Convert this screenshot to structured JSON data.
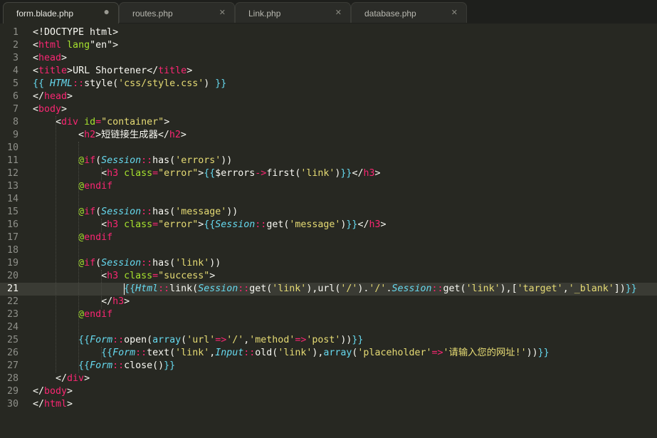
{
  "tabs": [
    {
      "title": "form.blade.php",
      "active": true,
      "dirty": true
    },
    {
      "title": "routes.php",
      "active": false
    },
    {
      "title": "Link.php",
      "active": false
    },
    {
      "title": "database.php",
      "active": false
    }
  ],
  "close_glyph": "✕",
  "dirty_glyph": "●",
  "current_line": 21,
  "colors": {
    "background": "#272822",
    "tag": "#f92672",
    "attribute": "#a6e22e",
    "string": "#e6db74",
    "blade_brace": "#66d9ef",
    "text": "#f8f8f2"
  },
  "lines": [
    [
      [
        "t",
        "<!DOCTYPE html>"
      ]
    ],
    [
      [
        "g",
        "<"
      ],
      [
        "k",
        "html"
      ],
      [
        "a",
        " lang"
      ],
      [
        "t",
        "\"en\""
      ],
      [
        "g",
        ">"
      ]
    ],
    [
      [
        "g",
        "<"
      ],
      [
        "k",
        "head"
      ],
      [
        "g",
        ">"
      ]
    ],
    [
      [
        "g",
        "<"
      ],
      [
        "k",
        "title"
      ],
      [
        "g",
        ">"
      ],
      [
        "t",
        "URL Shortener"
      ],
      [
        "g",
        "</"
      ],
      [
        "k",
        "title"
      ],
      [
        "g",
        ">"
      ]
    ],
    [
      [
        "b",
        "{{ "
      ],
      [
        "c",
        "HTML"
      ],
      [
        "o",
        "::"
      ],
      [
        "t",
        "style("
      ],
      [
        "s",
        "'css/style.css'"
      ],
      [
        "t",
        ") "
      ],
      [
        "b",
        "}}"
      ]
    ],
    [
      [
        "g",
        "</"
      ],
      [
        "k",
        "head"
      ],
      [
        "g",
        ">"
      ]
    ],
    [
      [
        "g",
        "<"
      ],
      [
        "k",
        "body"
      ],
      [
        "g",
        ">"
      ]
    ],
    [
      [
        "t",
        "    "
      ],
      [
        "g",
        "<"
      ],
      [
        "k",
        "div"
      ],
      [
        "a",
        " id"
      ],
      [
        "o",
        "="
      ],
      [
        "s",
        "\"container\""
      ],
      [
        "g",
        ">"
      ]
    ],
    [
      [
        "t",
        "        "
      ],
      [
        "g",
        "<"
      ],
      [
        "k",
        "h2"
      ],
      [
        "g",
        ">"
      ],
      [
        "t",
        "短链接生成器"
      ],
      [
        "g",
        "</"
      ],
      [
        "k",
        "h2"
      ],
      [
        "g",
        ">"
      ]
    ],
    [],
    [
      [
        "t",
        "        "
      ],
      [
        "at",
        "@"
      ],
      [
        "k",
        "if"
      ],
      [
        "t",
        "("
      ],
      [
        "c",
        "Session"
      ],
      [
        "o",
        "::"
      ],
      [
        "t",
        "has("
      ],
      [
        "s",
        "'errors'"
      ],
      [
        "t",
        "))"
      ]
    ],
    [
      [
        "t",
        "            "
      ],
      [
        "g",
        "<"
      ],
      [
        "k",
        "h3"
      ],
      [
        "a",
        " class"
      ],
      [
        "o",
        "="
      ],
      [
        "s",
        "\"error\""
      ],
      [
        "g",
        ">"
      ],
      [
        "b",
        "{{"
      ],
      [
        "t",
        "$errors"
      ],
      [
        "o",
        "->"
      ],
      [
        "t",
        "first("
      ],
      [
        "s",
        "'link'"
      ],
      [
        "t",
        ")"
      ],
      [
        "b",
        "}}"
      ],
      [
        "g",
        "</"
      ],
      [
        "k",
        "h3"
      ],
      [
        "g",
        ">"
      ]
    ],
    [
      [
        "t",
        "        "
      ],
      [
        "at",
        "@"
      ],
      [
        "k",
        "endif"
      ]
    ],
    [],
    [
      [
        "t",
        "        "
      ],
      [
        "at",
        "@"
      ],
      [
        "k",
        "if"
      ],
      [
        "t",
        "("
      ],
      [
        "c",
        "Session"
      ],
      [
        "o",
        "::"
      ],
      [
        "t",
        "has("
      ],
      [
        "s",
        "'message'"
      ],
      [
        "t",
        "))"
      ]
    ],
    [
      [
        "t",
        "            "
      ],
      [
        "g",
        "<"
      ],
      [
        "k",
        "h3"
      ],
      [
        "a",
        " class"
      ],
      [
        "o",
        "="
      ],
      [
        "s",
        "\"error\""
      ],
      [
        "g",
        ">"
      ],
      [
        "b",
        "{{"
      ],
      [
        "c",
        "Session"
      ],
      [
        "o",
        "::"
      ],
      [
        "t",
        "get("
      ],
      [
        "s",
        "'message'"
      ],
      [
        "t",
        ")"
      ],
      [
        "b",
        "}}"
      ],
      [
        "g",
        "</"
      ],
      [
        "k",
        "h3"
      ],
      [
        "g",
        ">"
      ]
    ],
    [
      [
        "t",
        "        "
      ],
      [
        "at",
        "@"
      ],
      [
        "k",
        "endif"
      ]
    ],
    [],
    [
      [
        "t",
        "        "
      ],
      [
        "at",
        "@"
      ],
      [
        "k",
        "if"
      ],
      [
        "t",
        "("
      ],
      [
        "c",
        "Session"
      ],
      [
        "o",
        "::"
      ],
      [
        "t",
        "has("
      ],
      [
        "s",
        "'link'"
      ],
      [
        "t",
        "))"
      ]
    ],
    [
      [
        "t",
        "            "
      ],
      [
        "g",
        "<"
      ],
      [
        "k",
        "h3"
      ],
      [
        "a",
        " class"
      ],
      [
        "o",
        "="
      ],
      [
        "s",
        "\"success\""
      ],
      [
        "g",
        ">"
      ]
    ],
    [
      [
        "t",
        "                "
      ],
      [
        "b",
        "{{"
      ],
      [
        "c",
        "Html"
      ],
      [
        "o",
        "::"
      ],
      [
        "t",
        "link("
      ],
      [
        "c",
        "Session"
      ],
      [
        "o",
        "::"
      ],
      [
        "t",
        "get("
      ],
      [
        "s",
        "'link'"
      ],
      [
        "t",
        "),url("
      ],
      [
        "s",
        "'/'"
      ],
      [
        "t",
        ")."
      ],
      [
        "s",
        "'/'"
      ],
      [
        "t",
        "."
      ],
      [
        "c",
        "Session"
      ],
      [
        "o",
        "::"
      ],
      [
        "t",
        "get("
      ],
      [
        "s",
        "'link'"
      ],
      [
        "t",
        "),["
      ],
      [
        "s",
        "'target'"
      ],
      [
        "t",
        ","
      ],
      [
        "s",
        "'_blank'"
      ],
      [
        "t",
        "])"
      ],
      [
        "b",
        "}}"
      ]
    ],
    [
      [
        "t",
        "            "
      ],
      [
        "g",
        "</"
      ],
      [
        "k",
        "h3"
      ],
      [
        "g",
        ">"
      ]
    ],
    [
      [
        "t",
        "        "
      ],
      [
        "at",
        "@"
      ],
      [
        "k",
        "endif"
      ]
    ],
    [],
    [
      [
        "t",
        "        "
      ],
      [
        "b",
        "{{"
      ],
      [
        "c",
        "Form"
      ],
      [
        "o",
        "::"
      ],
      [
        "t",
        "open("
      ],
      [
        "f",
        "array"
      ],
      [
        "t",
        "("
      ],
      [
        "s",
        "'url'"
      ],
      [
        "o",
        "=>"
      ],
      [
        "s",
        "'/'"
      ],
      [
        "t",
        ","
      ],
      [
        "s",
        "'method'"
      ],
      [
        "o",
        "=>"
      ],
      [
        "s",
        "'post'"
      ],
      [
        "t",
        "))"
      ],
      [
        "b",
        "}}"
      ]
    ],
    [
      [
        "t",
        "            "
      ],
      [
        "b",
        "{{"
      ],
      [
        "c",
        "Form"
      ],
      [
        "o",
        "::"
      ],
      [
        "t",
        "text("
      ],
      [
        "s",
        "'link'"
      ],
      [
        "t",
        ","
      ],
      [
        "c",
        "Input"
      ],
      [
        "o",
        "::"
      ],
      [
        "t",
        "old("
      ],
      [
        "s",
        "'link'"
      ],
      [
        "t",
        "),"
      ],
      [
        "f",
        "array"
      ],
      [
        "t",
        "("
      ],
      [
        "s",
        "'placeholder'"
      ],
      [
        "o",
        "=>"
      ],
      [
        "s",
        "'请输入您的网址!'"
      ],
      [
        "t",
        "))"
      ],
      [
        "b",
        "}}"
      ]
    ],
    [
      [
        "t",
        "        "
      ],
      [
        "b",
        "{{"
      ],
      [
        "c",
        "Form"
      ],
      [
        "o",
        "::"
      ],
      [
        "t",
        "close()"
      ],
      [
        "b",
        "}}"
      ]
    ],
    [
      [
        "t",
        "    "
      ],
      [
        "g",
        "</"
      ],
      [
        "k",
        "div"
      ],
      [
        "g",
        ">"
      ]
    ],
    [
      [
        "g",
        "</"
      ],
      [
        "k",
        "body"
      ],
      [
        "g",
        ">"
      ]
    ],
    [
      [
        "g",
        "</"
      ],
      [
        "k",
        "html"
      ],
      [
        "g",
        ">"
      ]
    ]
  ]
}
